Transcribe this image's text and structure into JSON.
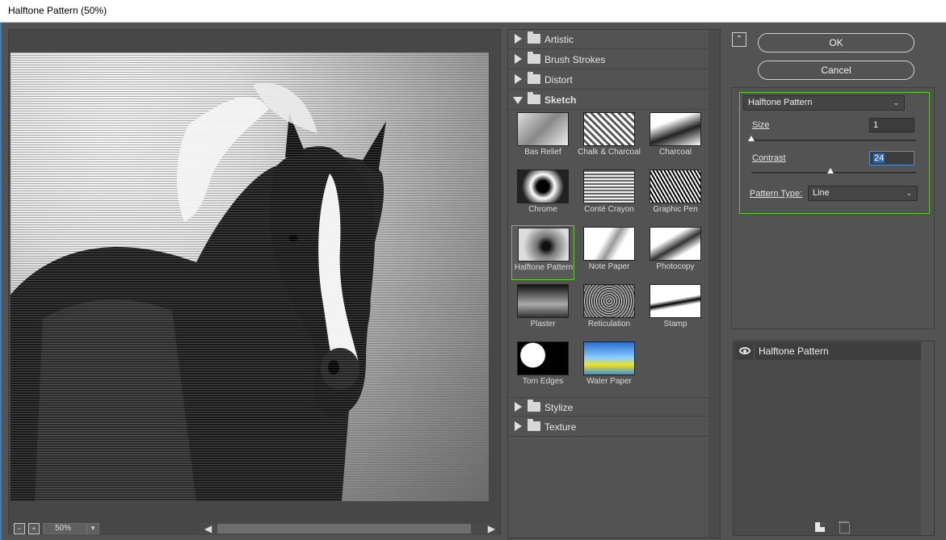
{
  "window": {
    "title": "Halftone Pattern (50%)"
  },
  "preview": {
    "zoom": "50%"
  },
  "gallery": {
    "categories_top": [
      {
        "label": "Artistic",
        "open": false
      },
      {
        "label": "Brush Strokes",
        "open": false
      },
      {
        "label": "Distort",
        "open": false
      },
      {
        "label": "Sketch",
        "open": true
      }
    ],
    "sketch_filters": [
      "Bas Relief",
      "Chalk & Charcoal",
      "Charcoal",
      "Chrome",
      "Conté Crayon",
      "Graphic Pen",
      "Halftone Pattern",
      "Note Paper",
      "Photocopy",
      "Plaster",
      "Reticulation",
      "Stamp",
      "Torn Edges",
      "Water Paper"
    ],
    "selected_filter": "Halftone Pattern",
    "categories_bottom": [
      {
        "label": "Stylize",
        "open": false
      },
      {
        "label": "Texture",
        "open": false
      }
    ]
  },
  "buttons": {
    "ok": "OK",
    "cancel": "Cancel"
  },
  "settings": {
    "filter_select": "Halftone Pattern",
    "size": {
      "label": "Size",
      "value": "1",
      "slider_fraction": 0.0
    },
    "contrast": {
      "label": "Contrast",
      "value": "24",
      "slider_fraction": 0.48
    },
    "pattern_type": {
      "label": "Pattern Type:",
      "value": "Line"
    }
  },
  "layers": [
    {
      "name": "Halftone Pattern",
      "visible": true
    }
  ],
  "colors": {
    "accent_selection": "#5ccc2e",
    "focus": "#4f8fd6"
  }
}
